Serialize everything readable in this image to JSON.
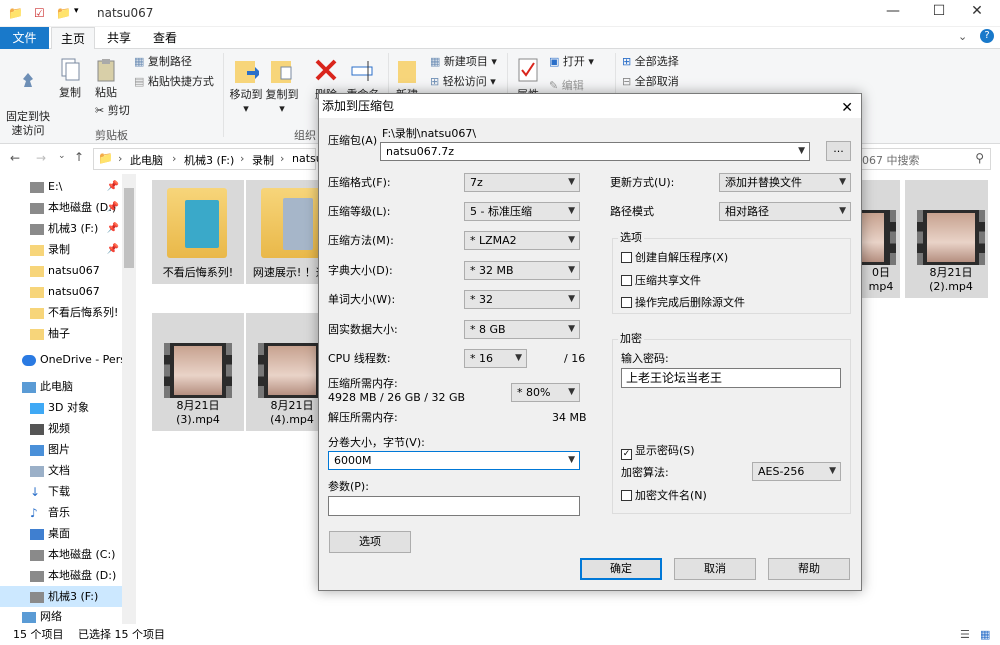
{
  "window": {
    "title": "natsu067"
  },
  "tabs": {
    "file": "文件",
    "home": "主页",
    "share": "共享",
    "view": "查看"
  },
  "ribbon": {
    "pin_quick": "固定到快\n速访问",
    "copy": "复制",
    "paste": "粘贴",
    "copy_path": "复制路径",
    "paste_shortcut": "粘贴快捷方式",
    "cut": "剪切",
    "clipboard": "剪贴板",
    "move_to": "移动到",
    "copy_to": "复制到",
    "delete": "删除",
    "rename": "重命名",
    "organize": "组织",
    "new_item": "新建项目",
    "easy_access": "轻松访问",
    "new_folder": "新建",
    "open": "打开",
    "edit": "编辑",
    "properties": "属性",
    "select_all": "全部选择",
    "select_none": "全部取消"
  },
  "address": {
    "path": [
      "此电脑",
      "机械3 (F:)",
      "录制",
      "natsu"
    ],
    "search": "067 中搜索"
  },
  "nav": {
    "items": [
      "E:\\",
      "本地磁盘 (D:)",
      "机械3 (F:)",
      "录制",
      "natsu067",
      "natsu067",
      "不看后悔系列!",
      "柚子",
      "OneDrive - Pers",
      "此电脑",
      "3D 对象",
      "视频",
      "图片",
      "文档",
      "下载",
      "音乐",
      "桌面",
      "本地磁盘 (C:)",
      "本地磁盘 (D:)",
      "机械3 (F:)",
      "网络"
    ]
  },
  "files": {
    "folder1": "不看后悔系列!",
    "folder2": "网速展示! ！逼!",
    "vid_a": "8月21日\n(3).mp4",
    "vid_b": "8月21日\n(4).mp4",
    "vid_c": "0日\nmp4",
    "vid_d": "8月21日\n(2).mp4"
  },
  "status": {
    "count": "15 个项目",
    "selected": "已选择 15 个项目"
  },
  "dialog": {
    "title": "添加到压缩包",
    "archive_label": "压缩包(A)",
    "archive_path": "F:\\录制\\natsu067\\",
    "archive_name": "natsu067.7z",
    "browse": "...",
    "format_label": "压缩格式(F):",
    "format": "7z",
    "level_label": "压缩等级(L):",
    "level": "5 - 标准压缩",
    "method_label": "压缩方法(M):",
    "method": "* LZMA2",
    "dict_label": "字典大小(D):",
    "dict": "* 32 MB",
    "word_label": "单词大小(W):",
    "word": "* 32",
    "solid_label": "固实数据大小:",
    "solid": "* 8 GB",
    "cpu_label": "CPU 线程数:",
    "cpu": "* 16",
    "cpu_total": "/ 16",
    "mem_label": "压缩所需内存:",
    "mem_value": "4928 MB / 26 GB / 32 GB",
    "mem_percent": "* 80%",
    "dmem_label": "解压所需内存:",
    "dmem_value": "34 MB",
    "split_label": "分卷大小，字节(V):",
    "split": "6000M",
    "params_label": "参数(P):",
    "params": "",
    "options_btn": "选项",
    "update_label": "更新方式(U):",
    "update": "添加并替换文件",
    "pathmode_label": "路径模式",
    "pathmode": "相对路径",
    "opt_group": "选项",
    "opt_sfx": "创建自解压程序(X)",
    "opt_shared": "压缩共享文件",
    "opt_delete": "操作完成后删除源文件",
    "enc_group": "加密",
    "pwd_label": "输入密码:",
    "pwd": "上老王论坛当老王",
    "show_pwd": "显示密码(S)",
    "enc_method_label": "加密算法:",
    "enc_method": "AES-256",
    "enc_names": "加密文件名(N)",
    "ok": "确定",
    "cancel": "取消",
    "help": "帮助"
  }
}
